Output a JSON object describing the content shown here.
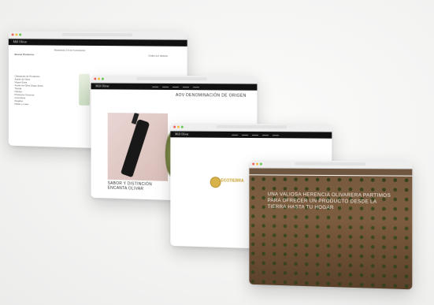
{
  "windows": {
    "shop": {
      "logo": "Mill Olivar",
      "breadcrumb": "Mostrando 1-6 de 6 productos",
      "filter_label": "Buscar Productos",
      "sort_label": "Orden por defecto",
      "sidebar_items": [
        "Categorías de Productos",
        "Aceite de Oliva",
        "Virgen Extra",
        "Aceite de Oliva Virgen Extra",
        "Tienda",
        "Ofertas",
        "Productos Gourmet",
        "Cosmética",
        "Regalos",
        "Packs y Lotes"
      ]
    },
    "product": {
      "logo": "Mill Olivar",
      "headline": "AOV DENOMINACIÓN DE ORIGEN",
      "subline": "SABOR Y DISTINCIÓN ENCANTA OLIVAR"
    },
    "eco": {
      "logo": "Mill Olivar",
      "badge": "ECOTIERRA"
    },
    "hero": {
      "headline": "UNA VALIOSA HERENCIA OLIVARERA PARTIMOS PARA OFRECER UN PRODUCTO DESDE LA TIERRA HASTA TU HOGAR"
    }
  },
  "colors": {
    "site_bar": "#111111",
    "soil": "#7a5a3c",
    "olive_tree": "#3e4a21",
    "medal_gold": "#d8b24a"
  }
}
